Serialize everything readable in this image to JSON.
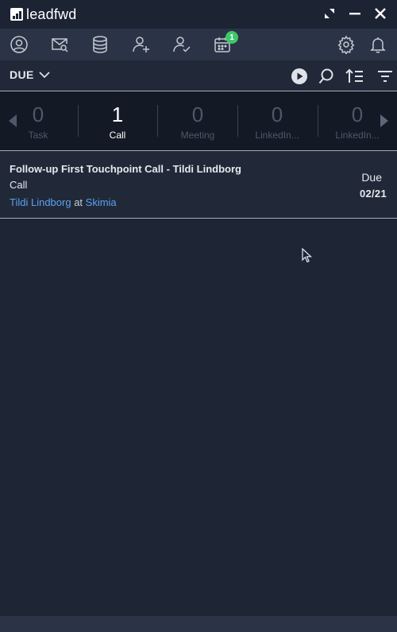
{
  "app": {
    "name": "leadfwd"
  },
  "window_controls": [
    "resize-icon",
    "minimize-icon",
    "close-icon"
  ],
  "nav": {
    "icons": [
      "profile-icon",
      "email-search-icon",
      "database-icon",
      "add-contact-icon",
      "contact-check-icon",
      "calendar-icon",
      "settings-icon",
      "bell-icon"
    ],
    "calendar_badge": "1",
    "badge_color": "#3fc86a"
  },
  "filter": {
    "selected": "DUE",
    "tools": [
      "play-icon",
      "search-icon",
      "sort-icon",
      "filter-icon"
    ]
  },
  "counters": [
    {
      "count": "0",
      "label": "Task",
      "active": false
    },
    {
      "count": "1",
      "label": "Call",
      "active": true
    },
    {
      "count": "0",
      "label": "Meeting",
      "active": false
    },
    {
      "count": "0",
      "label": "LinkedIn...",
      "active": false
    },
    {
      "count": "0",
      "label": "LinkedIn...",
      "active": false
    }
  ],
  "tasks": [
    {
      "title": "Follow-up First Touchpoint Call - Tildi Lindborg",
      "type": "Call",
      "contact_name": "Tildi Lindborg",
      "at": "at",
      "company": "Skimia",
      "due_label": "Due",
      "due_date": "02/21"
    }
  ],
  "colors": {
    "background": "#1e2636",
    "titlebar": "#1c2333",
    "navbar": "#2b3446",
    "counter_strip": "#131a26",
    "link": "#5aa0f0"
  }
}
